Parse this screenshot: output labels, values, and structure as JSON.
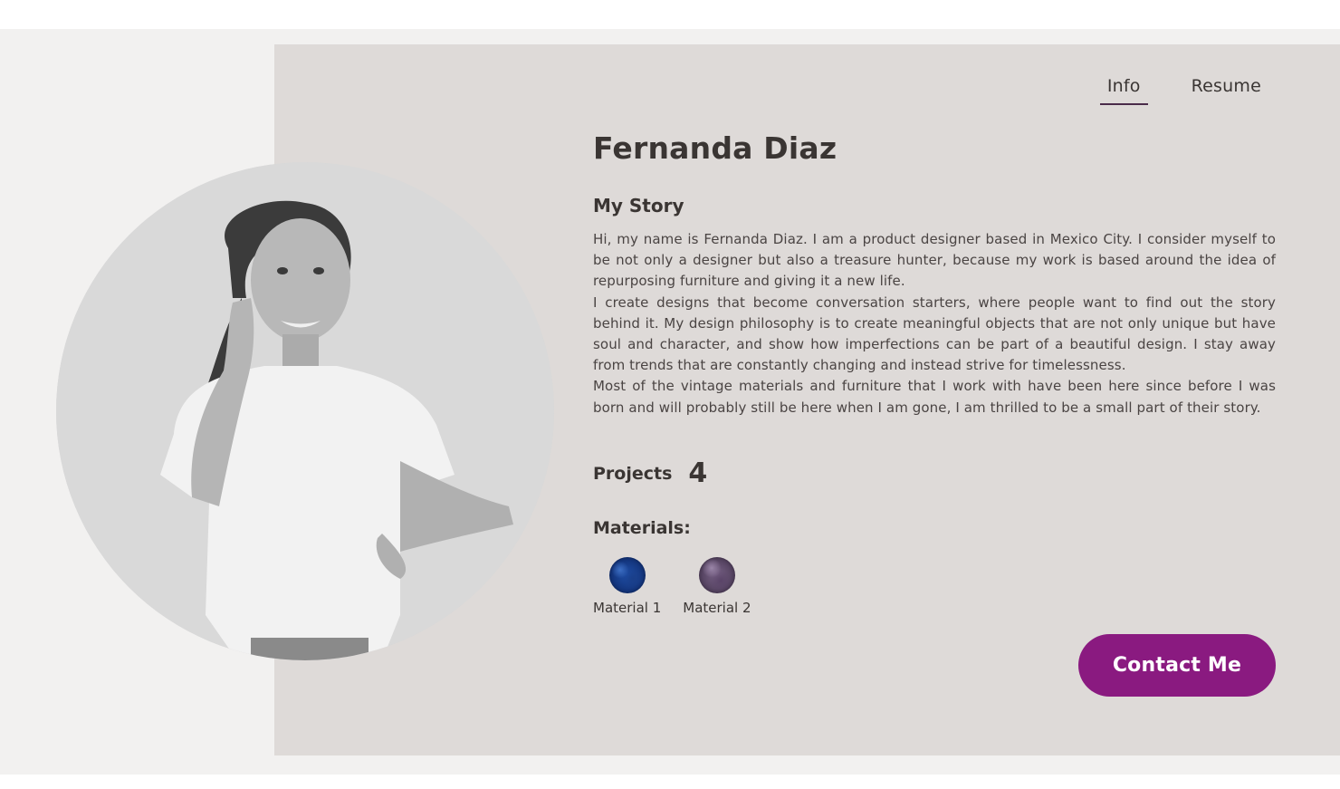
{
  "nav": {
    "tabs": [
      {
        "label": "Info",
        "active": true
      },
      {
        "label": "Resume",
        "active": false
      }
    ]
  },
  "profile": {
    "name": "Fernanda Diaz",
    "photo_icon": "portrait-photo"
  },
  "story": {
    "title": "My Story",
    "paragraphs": [
      "Hi, my name is Fernanda Diaz. I am a product designer based in Mexico City. I consider myself to be not only a designer but also a treasure hunter, because my work is based around the idea of repurposing furniture and giving it a new life.",
      "I create designs that become conversation starters, where people want to find out the story behind it. My design philosophy is to create meaningful objects that are not only unique but have soul and character, and show how imperfections can be part of a beautiful design. I stay away from trends that are constantly changing and instead strive for timelessness.",
      "Most of the vintage materials and furniture that I work with have been here since before I was born and will probably still be here when I am gone, I am thrilled to be a small part of their story."
    ]
  },
  "projects": {
    "label": "Projects",
    "count": "4"
  },
  "materials": {
    "title": "Materials:",
    "items": [
      {
        "label": "Material 1",
        "color": "#1f4fa8"
      },
      {
        "label": "Material 2",
        "color": "#7a6488"
      }
    ]
  },
  "contact": {
    "label": "Contact Me",
    "color": "#8a1a80"
  }
}
